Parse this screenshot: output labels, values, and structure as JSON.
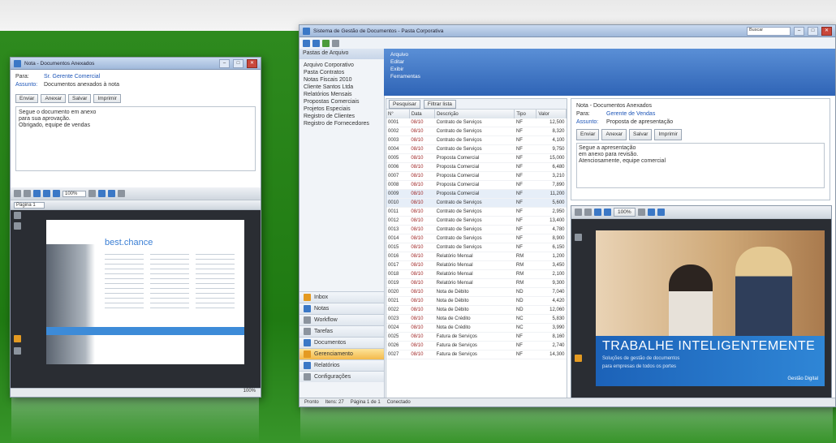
{
  "win1": {
    "title": "Nota - Documentos Anexados",
    "fields": [
      {
        "label": "Para:",
        "value": "Sr. Gerente Comercial"
      },
      {
        "label": "Assunto:",
        "value": "Documentos anexados à nota"
      }
    ],
    "buttons": [
      "Enviar",
      "Anexar",
      "Salvar",
      "Imprimir"
    ],
    "note_lines": [
      "Segue o documento em anexo",
      "para sua aprovação.",
      "Obrigado, equipe de vendas"
    ],
    "zoom": "100%",
    "page_selector": "Página 1",
    "doc_heading": "best.chance",
    "status": "100%"
  },
  "win2": {
    "title": "Sistema de Gestão de Documentos - Pasta Corporativa",
    "search_placeholder": "Buscar",
    "tree_header": "Pastas de Arquivo",
    "tree_items": [
      "Arquivo Corporativo",
      "Pasta Contratos",
      "Notas Fiscais 2010",
      "Cliente Santos Ltda",
      "Relatórios Mensais",
      "Propostas Comerciais",
      "Projetos Especiais",
      "Registro de Clientes",
      "Registro de Fornecedores"
    ],
    "nav_items": [
      {
        "label": "Inbox",
        "icon": "inbox-icon",
        "selected": false
      },
      {
        "label": "Notas",
        "icon": "notes-icon",
        "selected": false
      },
      {
        "label": "Workflow",
        "icon": "workflow-icon",
        "selected": false
      },
      {
        "label": "Tarefas",
        "icon": "tasks-icon",
        "selected": false
      },
      {
        "label": "Documentos",
        "icon": "documents-icon",
        "selected": false
      },
      {
        "label": "Gerenciamento",
        "icon": "management-icon",
        "selected": true
      },
      {
        "label": "Relatórios",
        "icon": "reports-icon",
        "selected": false
      },
      {
        "label": "Configurações",
        "icon": "settings-icon",
        "selected": false
      }
    ],
    "ribbon_items": [
      "Arquivo",
      "Editar",
      "Exibir",
      "Ferramentas"
    ],
    "list_toolbar": [
      "Pesquisar",
      "Filtrar lista"
    ],
    "columns": [
      "N°",
      "Data",
      "Descrição",
      "Tipo",
      "Valor"
    ],
    "rows": [
      [
        "0001",
        "08/10",
        "Contrato de Serviços",
        "NF",
        "12,500"
      ],
      [
        "0002",
        "08/10",
        "Contrato de Serviços",
        "NF",
        "8,320"
      ],
      [
        "0003",
        "08/10",
        "Contrato de Serviços",
        "NF",
        "4,100"
      ],
      [
        "0004",
        "08/10",
        "Contrato de Serviços",
        "NF",
        "9,750"
      ],
      [
        "0005",
        "08/10",
        "Proposta Comercial",
        "NF",
        "15,000"
      ],
      [
        "0006",
        "08/10",
        "Proposta Comercial",
        "NF",
        "6,480"
      ],
      [
        "0007",
        "08/10",
        "Proposta Comercial",
        "NF",
        "3,210"
      ],
      [
        "0008",
        "08/10",
        "Proposta Comercial",
        "NF",
        "7,890"
      ],
      [
        "0009",
        "08/10",
        "Proposta Comercial",
        "NF",
        "11,200"
      ],
      [
        "0010",
        "08/10",
        "Contrato de Serviços",
        "NF",
        "5,600"
      ],
      [
        "0011",
        "08/10",
        "Contrato de Serviços",
        "NF",
        "2,950"
      ],
      [
        "0012",
        "08/10",
        "Contrato de Serviços",
        "NF",
        "13,400"
      ],
      [
        "0013",
        "08/10",
        "Contrato de Serviços",
        "NF",
        "4,780"
      ],
      [
        "0014",
        "08/10",
        "Contrato de Serviços",
        "NF",
        "8,900"
      ],
      [
        "0015",
        "08/10",
        "Contrato de Serviços",
        "NF",
        "6,150"
      ],
      [
        "0016",
        "08/10",
        "Relatório Mensal",
        "RM",
        "1,200"
      ],
      [
        "0017",
        "08/10",
        "Relatório Mensal",
        "RM",
        "3,450"
      ],
      [
        "0018",
        "08/10",
        "Relatório Mensal",
        "RM",
        "2,100"
      ],
      [
        "0019",
        "08/10",
        "Relatório Mensal",
        "RM",
        "9,300"
      ],
      [
        "0020",
        "08/10",
        "Nota de Débito",
        "ND",
        "7,040"
      ],
      [
        "0021",
        "08/10",
        "Nota de Débito",
        "ND",
        "4,420"
      ],
      [
        "0022",
        "08/10",
        "Nota de Débito",
        "ND",
        "12,060"
      ],
      [
        "0023",
        "08/10",
        "Nota de Crédito",
        "NC",
        "5,830"
      ],
      [
        "0024",
        "08/10",
        "Nota de Crédito",
        "NC",
        "3,990"
      ],
      [
        "0025",
        "08/10",
        "Fatura de Serviços",
        "NF",
        "8,160"
      ],
      [
        "0026",
        "08/10",
        "Fatura de Serviços",
        "NF",
        "2,740"
      ],
      [
        "0027",
        "08/10",
        "Fatura de Serviços",
        "NF",
        "14,300"
      ]
    ],
    "detail_title": "Nota - Documentos Anexados",
    "detail_fields": [
      {
        "label": "Para:",
        "value": "Gerente de Vendas"
      },
      {
        "label": "Assunto:",
        "value": "Proposta de apresentação"
      }
    ],
    "detail_buttons": [
      "Enviar",
      "Anexar",
      "Salvar",
      "Imprimir"
    ],
    "detail_note": [
      "Segue a apresentação",
      "em anexo para revisão.",
      "Atenciosamente, equipe comercial"
    ],
    "viewer_zoom": "100%",
    "slide_title": "TRABALHE INTELIGENTEMENTE",
    "slide_sub": [
      "Soluções de gestão de documentos",
      "para empresas de todos os portes"
    ],
    "slide_logo": "Gestão Digital",
    "status_items": [
      "Pronto",
      "Itens: 27",
      "Página 1 de 1",
      "Conectado"
    ]
  }
}
